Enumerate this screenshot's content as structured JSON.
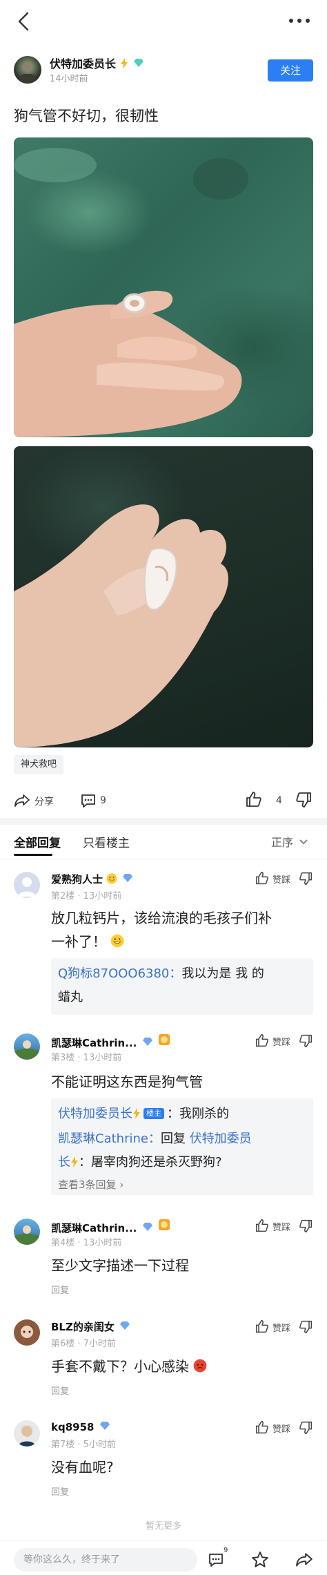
{
  "post": {
    "author": {
      "name": "伏特加委员长",
      "time": "14小时前"
    },
    "follow_label": "关注",
    "title": "狗气管不好切，很韧性",
    "tag": "神犬救吧"
  },
  "actions": {
    "share_label": "分享",
    "comment_count": "9",
    "like_count": "4"
  },
  "tabs": {
    "all_replies": "全部回复",
    "only_op": "只看楼主",
    "sort": "正序"
  },
  "comments": [
    {
      "name": "爱熟狗人士",
      "meta": "第2楼 · 13小时前",
      "like_label": "赞踩",
      "text_line1": "放几粒钙片，该给流浪的毛孩子们补",
      "text_line2": "一补了！",
      "quote_name": "Q狗标87OOO6380：",
      "quote_text1": "我以为是 我 的",
      "quote_text2": "蜡丸"
    },
    {
      "name": "凯瑟琳Cathrin...",
      "meta": "第3楼 · 13小时前",
      "like_label": "赞踩",
      "text": "不能证明这东西是狗气管",
      "sub_name1": "伏特加委员长",
      "sub_badge": "楼主",
      "sub_text1": "：我刚杀的",
      "sub_name2": "凯瑟琳Cathrine：",
      "sub_text2": "回复 ",
      "sub_name3": "伏特加委员",
      "sub_name4": "长",
      "sub_text3": "：屠宰肉狗还是杀灭野狗?",
      "see_more": "查看3条回复"
    },
    {
      "name": "凯瑟琳Cathrin...",
      "meta": "第4楼 · 13小时前",
      "like_label": "赞踩",
      "text": "至少文字描述一下过程",
      "reply": "回复"
    },
    {
      "name": "BLZ的亲闺女",
      "meta": "第6楼 · 7小时前",
      "like_label": "赞踩",
      "text": "手套不戴下？小心感染",
      "reply": "回复"
    },
    {
      "name": "kq8958",
      "meta": "第7楼 · 5小时前",
      "like_label": "赞踩",
      "text": "没有血呢?",
      "reply": "回复"
    }
  ],
  "footer": {
    "no_more": "暂无更多"
  },
  "bottom": {
    "input_placeholder": "等你这么久，终于来了",
    "comment_badge": "9"
  },
  "colors": {
    "accent": "#2b7ff3",
    "link": "#3a73c9"
  }
}
